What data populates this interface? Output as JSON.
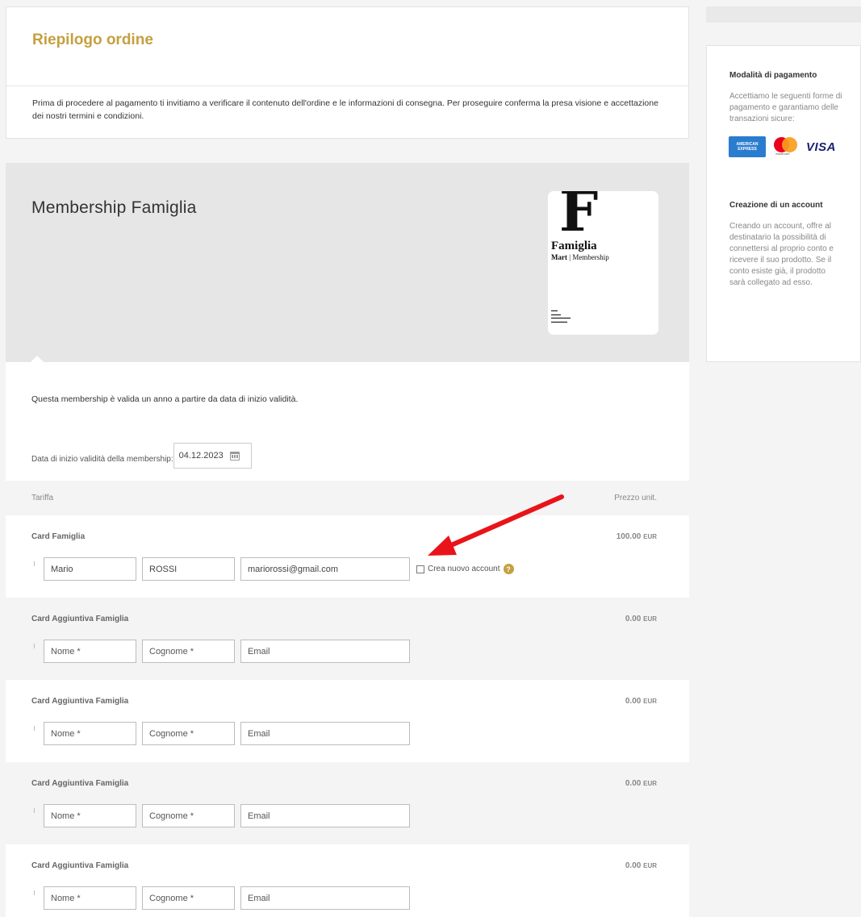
{
  "summary": {
    "title": "Riepilogo ordine",
    "intro": "Prima di procedere al pagamento ti invitiamo a verificare il contenuto dell'ordine e le informazioni di consegna. Per proseguire conferma la presa visione e accettazione dei nostri termini e condizioni."
  },
  "product": {
    "title": "Membership Famiglia",
    "image": {
      "letter": "F",
      "name": "Famiglia",
      "subtitle_brand": "Mart",
      "subtitle": "Membership"
    },
    "validity_text": "Questa membership è valida un anno a partire da data di inizio validità.",
    "date_label": "Data di inizio validità della membership:",
    "date_value": "04.12.2023"
  },
  "tariff": {
    "col_tariff": "Tariffa",
    "col_price": "Prezzo unit.",
    "account_label": "Crea nuovo account",
    "help_symbol": "?",
    "rows": [
      {
        "name": "Card Famiglia",
        "price": "100.00",
        "currency": "EUR",
        "first": "Mario",
        "last": "ROSSI",
        "email": "mariorossi@gmail.com"
      },
      {
        "name": "Card Aggiuntiva Famiglia",
        "price": "0.00",
        "currency": "EUR",
        "first_placeholder": "Nome *",
        "last_placeholder": "Cognome *",
        "email_placeholder": "Email"
      },
      {
        "name": "Card Aggiuntiva Famiglia",
        "price": "0.00",
        "currency": "EUR",
        "first_placeholder": "Nome *",
        "last_placeholder": "Cognome *",
        "email_placeholder": "Email"
      },
      {
        "name": "Card Aggiuntiva Famiglia",
        "price": "0.00",
        "currency": "EUR",
        "first_placeholder": "Nome *",
        "last_placeholder": "Cognome *",
        "email_placeholder": "Email"
      },
      {
        "name": "Card Aggiuntiva Famiglia",
        "price": "0.00",
        "currency": "EUR",
        "first_placeholder": "Nome *",
        "last_placeholder": "Cognome *",
        "email_placeholder": "Email"
      }
    ]
  },
  "sidebar": {
    "payment_title": "Modalità di pagamento",
    "payment_text": "Accettiamo le seguenti forme di pagamento e garantiamo delle transazioni sicure:",
    "logos": {
      "amex_line1": "AMERICAN",
      "amex_line2": "EXPRESS",
      "mastercard": "mastercard",
      "visa": "VISA"
    },
    "account_title": "Creazione di un account",
    "account_text": "Creando un account, offre al destinatario la possibilità di connettersi al proprio conto e ricevere il suo prodotto. Se il conto esiste già, il prodotto sarà collegato ad esso."
  },
  "colors": {
    "accent": "#c5a03f",
    "arrow": "#e8141a"
  }
}
